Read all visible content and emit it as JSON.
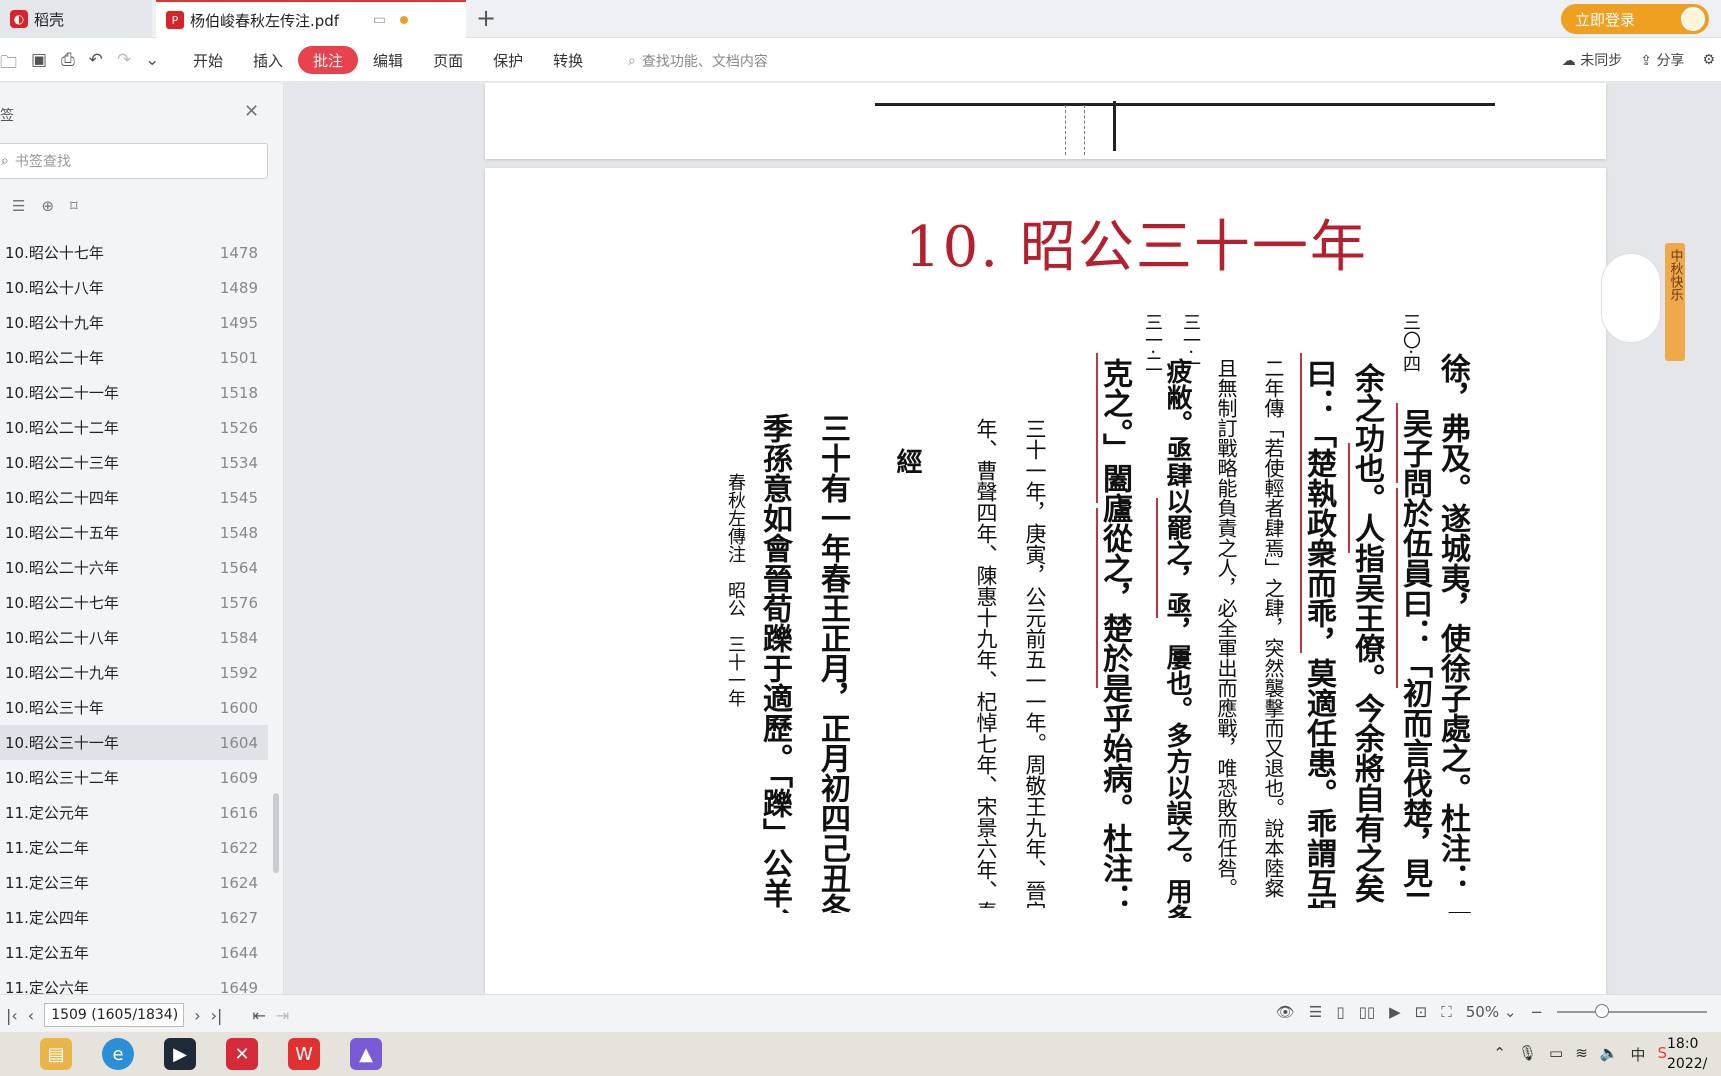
{
  "tabs": [
    {
      "label": "稻壳",
      "icon": "daoke-logo-icon"
    },
    {
      "label": "杨伯峻春秋左传注.pdf",
      "icon": "pdf-icon"
    }
  ],
  "account": {
    "login_label": "立即登录"
  },
  "toolbar": {
    "menus": [
      "开始",
      "插入",
      "批注",
      "编辑",
      "页面",
      "保护",
      "转换"
    ],
    "active_menu": "批注",
    "search_placeholder": "查找功能、文档内容",
    "sync_label": "未同步",
    "share_label": "分享"
  },
  "sidebar": {
    "title": "签",
    "search_placeholder": "书签查找",
    "bookmarks": [
      {
        "label": "10.昭公十七年",
        "page": "1478"
      },
      {
        "label": "10.昭公十八年",
        "page": "1489"
      },
      {
        "label": "10.昭公十九年",
        "page": "1495"
      },
      {
        "label": "10.昭公二十年",
        "page": "1501"
      },
      {
        "label": "10.昭公二十一年",
        "page": "1518"
      },
      {
        "label": "10.昭公二十二年",
        "page": "1526"
      },
      {
        "label": "10.昭公二十三年",
        "page": "1534"
      },
      {
        "label": "10.昭公二十四年",
        "page": "1545"
      },
      {
        "label": "10.昭公二十五年",
        "page": "1548"
      },
      {
        "label": "10.昭公二十六年",
        "page": "1564"
      },
      {
        "label": "10.昭公二十七年",
        "page": "1576"
      },
      {
        "label": "10.昭公二十八年",
        "page": "1584"
      },
      {
        "label": "10.昭公二十九年",
        "page": "1592"
      },
      {
        "label": "10.昭公三十年",
        "page": "1600"
      },
      {
        "label": "10.昭公三十一年",
        "page": "1604"
      },
      {
        "label": "10.昭公三十二年",
        "page": "1609"
      },
      {
        "label": "11.定公元年",
        "page": "1616"
      },
      {
        "label": "11.定公二年",
        "page": "1622"
      },
      {
        "label": "11.定公三年",
        "page": "1624"
      },
      {
        "label": "11.定公四年",
        "page": "1627"
      },
      {
        "label": "11.定公五年",
        "page": "1644"
      },
      {
        "label": "11.定公六年",
        "page": "1649"
      }
    ],
    "selected_index": 14
  },
  "document": {
    "page_title": "10. 昭公三十一年",
    "columns": [
      {
        "text": "徐，弗及。遂城夷，使徐子處之。杜注：「夷，城父",
        "size": 30
      },
      {
        "text": "吴子問於伍員曰：「初而言伐楚，見二十年傳",
        "size": 30
      },
      {
        "text": "余之功也。人指吴王僚。今余將自有之矣。自",
        "size": 30
      },
      {
        "text": "曰：「楚執政衆而乖，莫適任患。乖謂互相違戾。",
        "size": 30
      },
      {
        "text": "二年傳「若使輕者肆焉」之肆，突然襲擊而又退也。說本陸粲",
        "size": 20
      },
      {
        "text": "且無制訂戰略能負責之人，必全軍出而應戰，唯恐敗而任咎。",
        "size": 20
      },
      {
        "text": "疲敝。亟肆以罷之，亟，屢也。多方以誤之。用多",
        "size": 26
      },
      {
        "text": "克之。」闔廬從之，楚於是乎始病。杜注：「爲定四",
        "size": 30
      },
      {
        "text": "三十一年，庚寅，公元前五一一年。周敬王九年、晉定",
        "size": 21
      },
      {
        "text": "年、曹聲四年、陳惠十九年、杞悼七年、宋景六年、秦哀",
        "size": 21
      },
      {
        "text": "經",
        "size": 26
      },
      {
        "text": "三十有一年春王正月，正月初四己丑冬至，建",
        "size": 30
      },
      {
        "text": "季孫意如會晉荀躒于適歷。「躒」公羊、穀梁",
        "size": 30
      },
      {
        "text": "春秋左傳注　昭公　三十一年",
        "size": 18
      }
    ],
    "margin_numbers": [
      "三〇·四",
      "三一·一",
      "三一·二"
    ]
  },
  "statusbar": {
    "page_indicator": "1509 (1605/1834)",
    "zoom": "50%"
  },
  "taskbar": {
    "clock_time": "18:0",
    "clock_date": "2022/"
  },
  "mascot": {
    "text": "中秋快乐"
  },
  "colors": {
    "accent": "#e8424f",
    "title_red": "#b4202d",
    "login": "#f0a020"
  }
}
